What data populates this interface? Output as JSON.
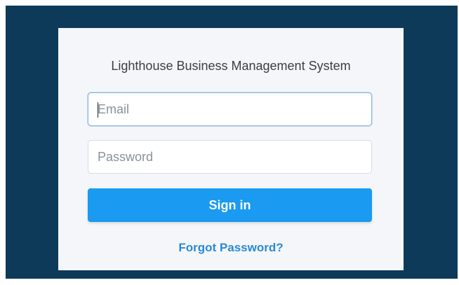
{
  "login": {
    "title": "Lighthouse Business Management System",
    "email_placeholder": "Email",
    "email_value": "",
    "password_placeholder": "Password",
    "password_value": "",
    "signin_label": "Sign in",
    "forgot_label": "Forgot Password?"
  },
  "colors": {
    "background": "#0e3a5a",
    "card": "#f4f6f9",
    "primary_button": "#1a9af0",
    "link": "#2a8ad8"
  }
}
